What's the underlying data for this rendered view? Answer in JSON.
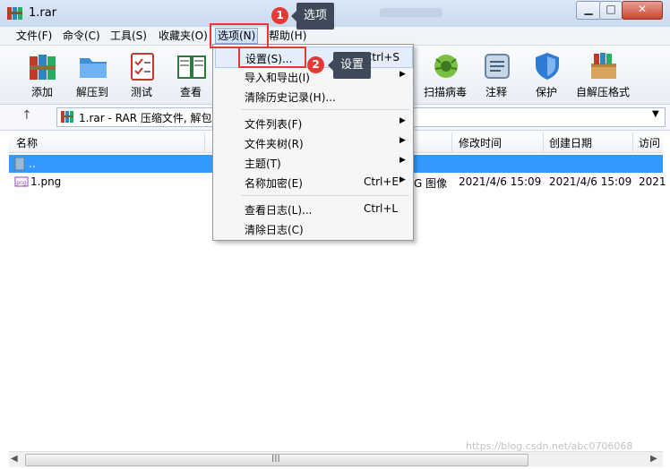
{
  "window": {
    "title": "1.rar",
    "controls": {
      "minimize": "▁",
      "maximize": "□",
      "close": "✕"
    }
  },
  "menubar": [
    "文件(F)",
    "命令(C)",
    "工具(S)",
    "收藏夹(O)",
    "选项(N)",
    "帮助(H)"
  ],
  "toolbar": [
    {
      "label": "添加",
      "icon": "books-icon"
    },
    {
      "label": "解压到",
      "icon": "folder-icon"
    },
    {
      "label": "测试",
      "icon": "checklist-icon"
    },
    {
      "label": "查看",
      "icon": "book-icon"
    },
    {
      "label": "扫描病毒",
      "icon": "bug-icon"
    },
    {
      "label": "注释",
      "icon": "note-icon"
    },
    {
      "label": "保护",
      "icon": "shield-icon"
    },
    {
      "label": "自解压格式",
      "icon": "package-icon"
    }
  ],
  "address": {
    "up_icon": "↑",
    "text": "1.rar - RAR 压缩文件, 解包",
    "dropdown": "▼"
  },
  "columns": {
    "name": "名称",
    "modified": "修改时间",
    "created": "创建日期",
    "accessed": "访问"
  },
  "rows": [
    {
      "name": "..",
      "type": "",
      "modified": "",
      "created": "",
      "accessed": ""
    },
    {
      "name": "1.png",
      "type": "G 图像",
      "modified": "2021/4/6 15:09",
      "created": "2021/4/6 15:09",
      "accessed": "2021"
    }
  ],
  "dropdown_menu": {
    "settings": {
      "label": "设置(S)...",
      "shortcut": "Ctrl+S"
    },
    "import_export": {
      "label": "导入和导出(I)",
      "arrow": "▶"
    },
    "clear_history": {
      "label": "清除历史记录(H)..."
    },
    "file_list": {
      "label": "文件列表(F)",
      "arrow": "▶"
    },
    "folder_tree": {
      "label": "文件夹树(R)",
      "arrow": "▶"
    },
    "theme": {
      "label": "主题(T)",
      "arrow": "▶"
    },
    "name_encrypt": {
      "label": "名称加密(E)",
      "shortcut": "Ctrl+E",
      "arrow": "▶"
    },
    "view_log": {
      "label": "查看日志(L)...",
      "shortcut": "Ctrl+L"
    },
    "clear_log": {
      "label": "清除日志(C)"
    }
  },
  "annotations": [
    {
      "number": "1",
      "tip": "选项"
    },
    {
      "number": "2",
      "tip": "设置"
    }
  ],
  "scrollbar": {
    "left": "◀",
    "right": "▶",
    "grip": "III"
  },
  "watermark": "https://blog.csdn.net/abc0706068",
  "colors": {
    "selection": "#3399ff",
    "annotation": "#e53935",
    "tooltip": "#3e4a59"
  }
}
